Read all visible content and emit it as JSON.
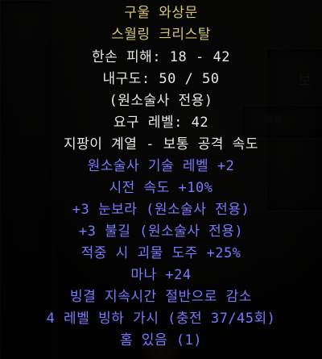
{
  "background": {
    "hint_bo": "보",
    "hint_gongyu": "공유"
  },
  "item": {
    "name": "구울 와상문",
    "base_type": "스월링 크리스탈",
    "base_stats": [
      "한손 피해: 18 - 42",
      "내구도: 50 / 50",
      "(원소술사 전용)",
      "요구 레벨: 42",
      "지팡이 계열 - 보통 공격 속도"
    ],
    "magic_properties": [
      "원소술사 기술 레벨 +2",
      "시전 속도 +10%",
      "+3 눈보라 (원소술사 전용)",
      "+3 불길 (원소술사 전용)",
      "적중 시 괴물 도주 +25%",
      "마나 +24",
      "빙결 지속시간 절반으로 감소",
      "4 레벨 빙하 가시 (충전 37/45회)",
      "홈 있음 (1)"
    ]
  },
  "colors": {
    "name_gold": "#d6c56f",
    "base_white": "#e8e8e8",
    "magic_blue": "#7a7aff",
    "tooltip_bg": "#000000"
  }
}
